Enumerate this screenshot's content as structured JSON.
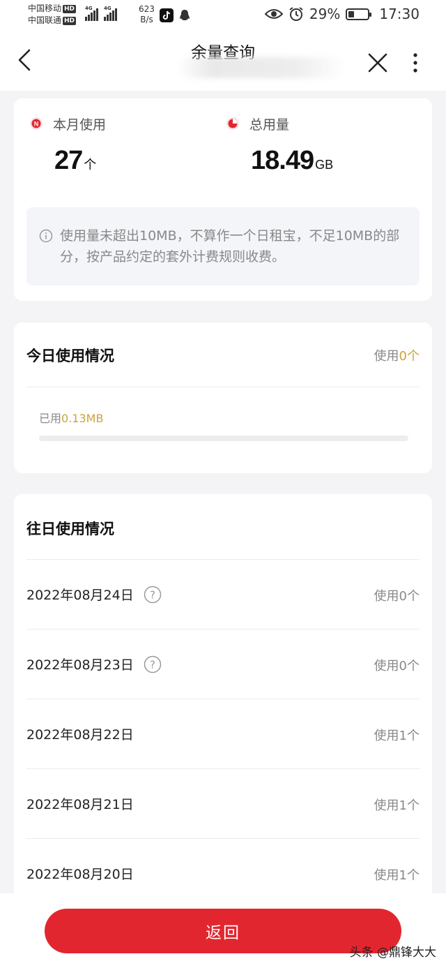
{
  "status_bar": {
    "carrier_1": "中国移动",
    "carrier_2": "中国联通",
    "hd": "HD",
    "net_type": "4G",
    "speed_value": "623",
    "speed_unit": "B/s",
    "battery": "29%",
    "battery_level": 0.29,
    "time": "17:30"
  },
  "nav": {
    "title": "余量查询"
  },
  "summary": {
    "month_label": "本月使用",
    "month_value": "27",
    "month_unit": "个",
    "total_label": "总用量",
    "total_value": "18.49",
    "total_unit": "GB",
    "notice": "使用量未超出10MB，不算作一个日租宝，不足10MB的部分，按产品约定的套外计费规则收费。",
    "month_icon_letter": "N"
  },
  "today": {
    "title": "今日使用情况",
    "usage_prefix": "使用",
    "usage_count": "0个",
    "used_prefix": "已用",
    "used_value": "0.13MB",
    "progress": 0.0
  },
  "history": {
    "title": "往日使用情况",
    "rows": [
      {
        "date": "2022年08月24日",
        "help": true,
        "usage": "使用0个"
      },
      {
        "date": "2022年08月23日",
        "help": true,
        "usage": "使用0个"
      },
      {
        "date": "2022年08月22日",
        "help": false,
        "usage": "使用1个"
      },
      {
        "date": "2022年08月21日",
        "help": false,
        "usage": "使用1个"
      },
      {
        "date": "2022年08月20日",
        "help": false,
        "usage": "使用1个"
      }
    ]
  },
  "footer": {
    "back_label": "返回",
    "watermark": "头条 @鼎锋大大"
  },
  "colors": {
    "accent_red": "#e2262f",
    "gold": "#c9a33c",
    "background": "#f4f4f6"
  },
  "icons": [
    "back-arrow-icon",
    "close-icon",
    "more-vertical-icon",
    "info-icon",
    "help-question-icon",
    "pie-chart-icon",
    "eye-icon",
    "alarm-icon",
    "battery-icon"
  ]
}
